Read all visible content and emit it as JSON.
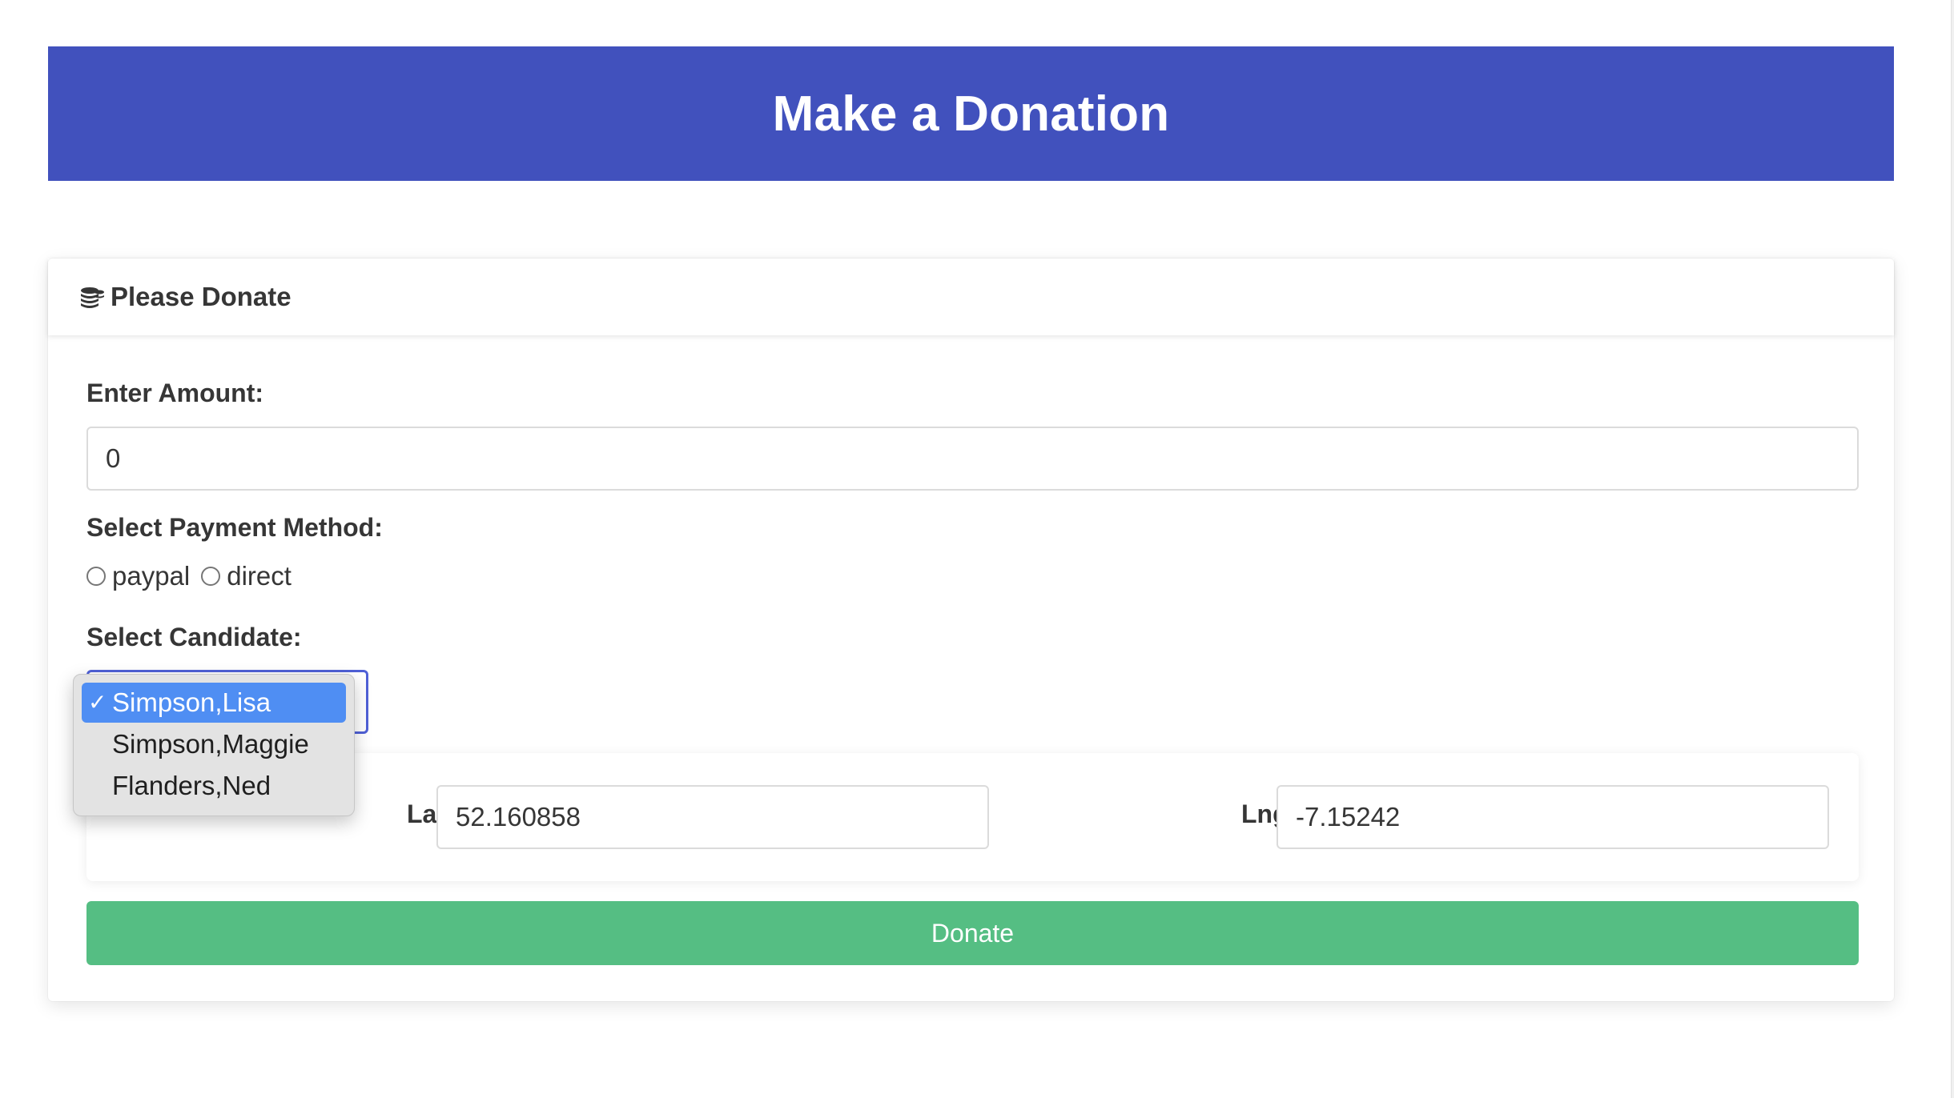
{
  "header": {
    "title": "Make a Donation"
  },
  "card": {
    "title": "Please Donate",
    "icon": "coins-icon"
  },
  "form": {
    "amount_label": "Enter Amount:",
    "amount_value": "0",
    "payment_label": "Select Payment Method:",
    "payment_options": [
      "paypal",
      "direct"
    ],
    "candidate_label": "Select Candidate:",
    "candidates": [
      {
        "label": "Simpson,Lisa",
        "selected": true
      },
      {
        "label": "Simpson,Maggie",
        "selected": false
      },
      {
        "label": "Flanders,Ned",
        "selected": false
      }
    ],
    "checkmark": "✓",
    "lat_label": "Lat",
    "lat_value": "52.160858",
    "lng_label": "Lng",
    "lng_value": "-7.15242",
    "submit_label": "Donate"
  },
  "colors": {
    "header_bg": "#4151bd",
    "button_bg": "#55be83",
    "dropdown_selected": "#4f8ef3",
    "select_focus": "#4f60d6"
  }
}
